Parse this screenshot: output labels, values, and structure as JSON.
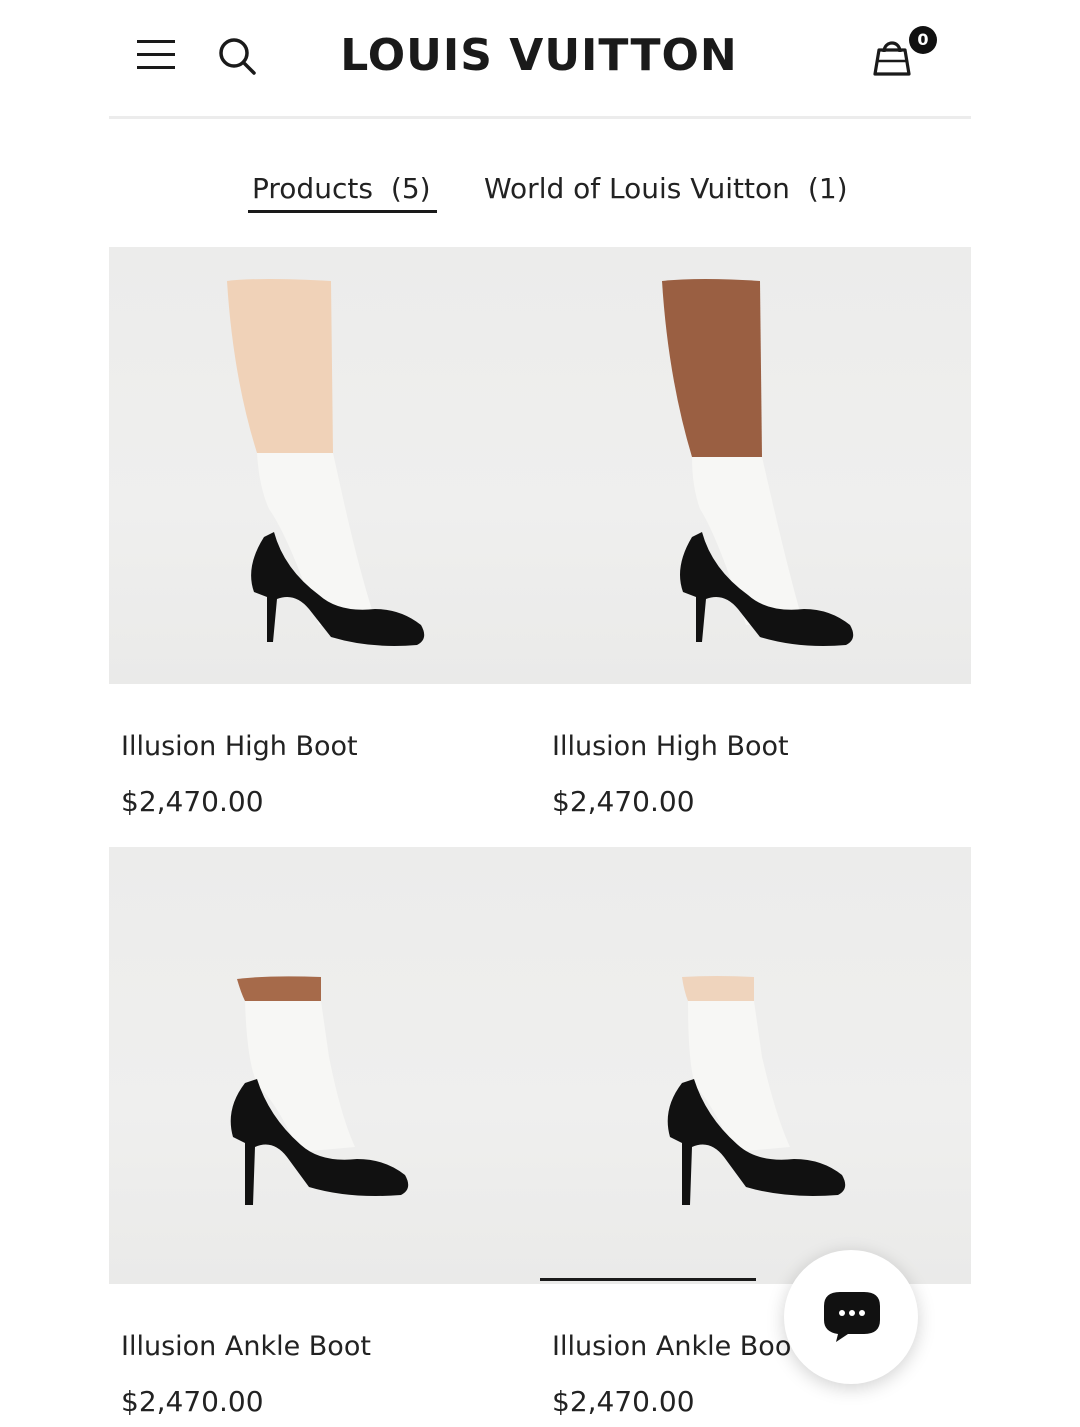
{
  "header": {
    "brand": "LOUIS VUITTON",
    "menu_icon": "hamburger-menu-icon",
    "search_icon": "search-icon",
    "bag_icon": "shopping-bag-icon",
    "bag_count": "0"
  },
  "tabs": [
    {
      "label": "Products",
      "count": "(5)",
      "active": true
    },
    {
      "label": "World of Louis Vuitton",
      "count": "(1)",
      "active": false
    }
  ],
  "products": [
    {
      "name": "Illusion High Boot",
      "price": "$2,470.00",
      "skin": "#f0d2b8"
    },
    {
      "name": "Illusion High Boot",
      "price": "$2,470.00",
      "skin": "#9a5f42"
    },
    {
      "name": "Illusion Ankle Boot",
      "price": "$2,470.00",
      "skin": "#a66a4a"
    },
    {
      "name": "Illusion Ankle Boot",
      "price": "$2,470.00",
      "skin": "#efd4bd"
    }
  ],
  "chat_icon": "chat-bubble-icon",
  "colors": {
    "text": "#1a1a1a",
    "image_bg": "#ededec",
    "shoe": "#111111"
  }
}
